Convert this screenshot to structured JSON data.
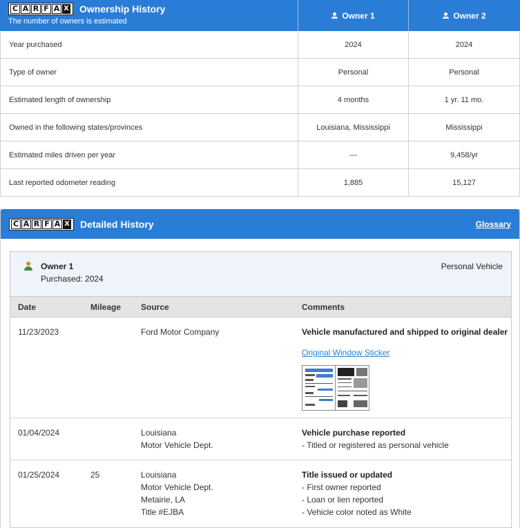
{
  "brand": {
    "letters": [
      "C",
      "A",
      "R",
      "F",
      "A",
      "X"
    ]
  },
  "ownership": {
    "title": "Ownership History",
    "subtitle": "The number of owners is estimated",
    "owner1_label": "Owner 1",
    "owner2_label": "Owner 2",
    "rows": [
      {
        "label": "Year purchased",
        "o1": "2024",
        "o2": "2024"
      },
      {
        "label": "Type of owner",
        "o1": "Personal",
        "o2": "Personal"
      },
      {
        "label": "Estimated length of ownership",
        "o1": "4 months",
        "o2": "1 yr. 11 mo."
      },
      {
        "label": "Owned in the following states/provinces",
        "o1": "Louisiana, Mississippi",
        "o2": "Mississippi"
      },
      {
        "label": "Estimated miles driven per year",
        "o1": "---",
        "o2": "9,458/yr"
      },
      {
        "label": "Last reported odometer reading",
        "o1": "1,885",
        "o2": "15,127"
      }
    ]
  },
  "detailed": {
    "title": "Detailed History",
    "glossary": "Glossary",
    "owner": {
      "name": "Owner 1",
      "purchased": "Purchased: 2024",
      "type": "Personal Vehicle"
    },
    "columns": {
      "date": "Date",
      "mileage": "Mileage",
      "source": "Source",
      "comments": "Comments"
    },
    "records": [
      {
        "date": "11/23/2023",
        "mileage": "",
        "source": [
          "Ford Motor Company"
        ],
        "comment_title": "Vehicle manufactured and shipped to original dealer",
        "comment_lines": [],
        "link": "Original Window Sticker"
      },
      {
        "date": "01/04/2024",
        "mileage": "",
        "source": [
          "Louisiana",
          "Motor Vehicle Dept."
        ],
        "comment_title": "Vehicle purchase reported",
        "comment_lines": [
          "- Titled or registered as personal vehicle"
        ]
      },
      {
        "date": "01/25/2024",
        "mileage": "25",
        "source": [
          "Louisiana",
          "Motor Vehicle Dept.",
          "Metairie, LA",
          "Title #EJBA"
        ],
        "comment_title": "Title issued or updated",
        "comment_lines": [
          "- First owner reported",
          "- Loan or lien reported",
          "- Vehicle color noted as White"
        ]
      }
    ]
  }
}
